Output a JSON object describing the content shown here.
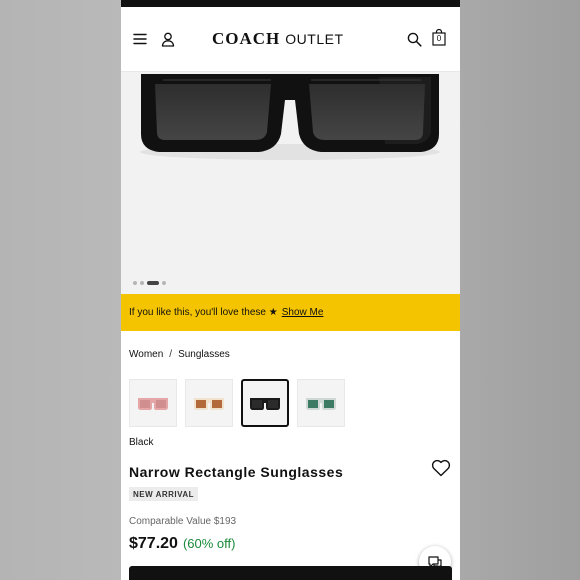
{
  "header": {
    "logo_brand": "COACH",
    "logo_suffix": "OUTLET",
    "bag_count": "0"
  },
  "gallery": {
    "slide_count": 4,
    "active_slide": 3
  },
  "banner": {
    "text": "If you like this, you'll love these ★",
    "link": "Show Me"
  },
  "breadcrumb": {
    "items": [
      "Women",
      "Sunglasses"
    ],
    "separator": "/"
  },
  "swatches": [
    {
      "name": "pink",
      "frame": "#e4a6a6",
      "lens": "#d18e8e",
      "selected": false
    },
    {
      "name": "tan",
      "frame": "#f0e2cc",
      "lens": "#b36a3a",
      "selected": false
    },
    {
      "name": "black",
      "frame": "#1a1a1a",
      "lens": "#2b2b2b",
      "selected": true
    },
    {
      "name": "green",
      "frame": "#cfd8d4",
      "lens": "#3d7a63",
      "selected": false
    }
  ],
  "product": {
    "color": "Black",
    "title": "Narrow Rectangle Sunglasses",
    "badge": "NEW ARRIVAL",
    "comparable": "Comparable Value $193",
    "price": "$77.20",
    "discount": "(60% off)"
  },
  "colors": {
    "banner": "#f5c400",
    "discount": "#1a8a3a"
  },
  "icons": [
    "menu-icon",
    "user-icon",
    "search-icon",
    "bag-icon",
    "heart-icon",
    "chat-icon"
  ]
}
